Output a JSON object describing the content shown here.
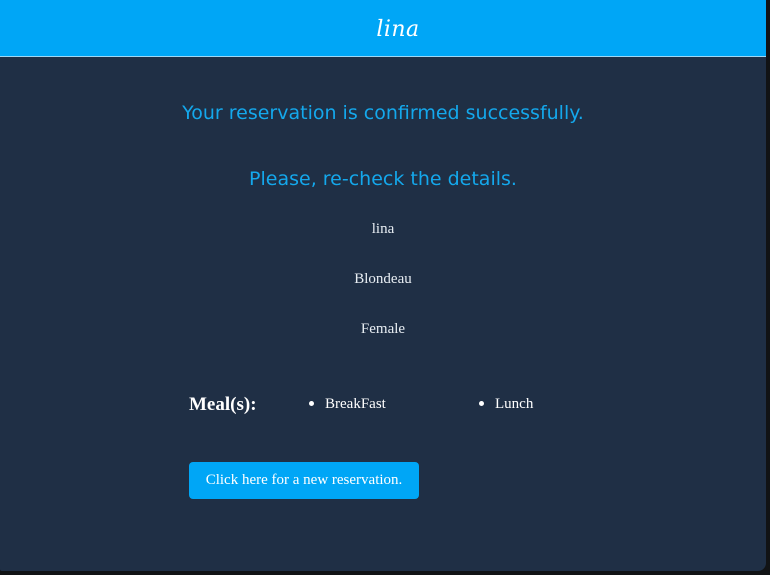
{
  "header": {
    "logo_text": "lina"
  },
  "confirmation": {
    "title": "Your reservation is confirmed successfully.",
    "subtitle": "Please, re-check the details."
  },
  "details": {
    "first_name": "lina",
    "last_name": "Blondeau",
    "gender": "Female"
  },
  "meals": {
    "label": "Meal(s):",
    "items": [
      "BreakFast",
      "Lunch"
    ]
  },
  "actions": {
    "new_reservation_label": "Click here for a new reservation."
  },
  "colors": {
    "header_bg": "#00a6f6",
    "page_bg": "#1f2f45",
    "accent_text": "#14a8ec"
  }
}
